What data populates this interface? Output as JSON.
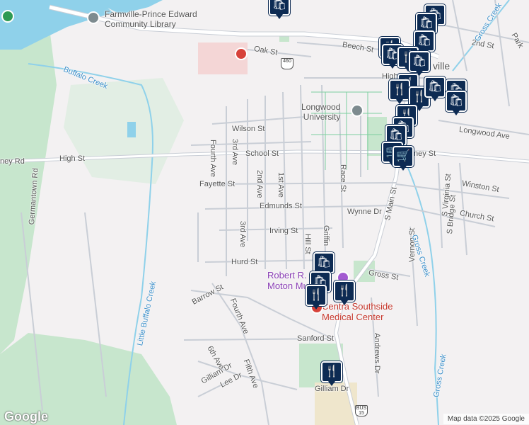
{
  "map": {
    "attribution": "Map data ©2025 Google",
    "logo": "Google",
    "colors": {
      "background": "#f3f1f2",
      "road": "#ffffff",
      "road_outline": "#c9ced6",
      "water": "#8fd1ea",
      "park": "#c7e6cd",
      "marker": "#0d2b53"
    }
  },
  "streets": {
    "high_st": "High St",
    "ney_rd": "ney Rd",
    "school_st": "School St",
    "wilson_st": "Wilson St",
    "fayette_st": "Fayette St",
    "edmunds_st": "Edmunds St",
    "irving_st": "Irving St",
    "hurd_st": "Hurd St",
    "barrow_st": "Barrow St",
    "sanford_st": "Sanford St",
    "gilliam_dr": "Gilliam Dr",
    "gilliam_dr_2": "Gilliam Dr",
    "lee_dr": "Lee Dr",
    "fifth_ave": "Fifth Ave",
    "sixth_ave": "6th Ave",
    "fourth_ave": "Fourth Ave",
    "fourth_ave_2": "Fourth Ave",
    "third_ave": "3rd Ave",
    "third_ave_2": "3rd Ave",
    "second_ave": "2nd Ave",
    "first_ave": "1st Ave",
    "hill_st": "Hill St",
    "griffin": "Griffin",
    "race_st": "Race St",
    "wynne_dr": "Wynne Dr",
    "s_main_st": "S Main St",
    "gross_st": "Gross St",
    "andrews_dr": "Andrews Dr",
    "vernon_st": "Vernon St",
    "s_virginia_st": "S Virginia St",
    "s_bridge_st": "S Bridge St",
    "church_st": "Church St",
    "winston_st": "Winston St",
    "longwood_ave": "Longwood Ave",
    "ney_st": "ney St",
    "oak_st": "Oak St",
    "beech_st": "Beech St",
    "high_fragment": "High",
    "second_st": "2nd St",
    "park_fragment": "Park",
    "germantown_rd": "Germantown Rd"
  },
  "water": {
    "buffalo_creek": "Buffalo Creek",
    "little_buffalo_creek": "Little Buffalo Creek",
    "gross_creek": "Gross Creek",
    "gross_creek_2": "Gross Creek",
    "gross_creek_3": "Gross Creek"
  },
  "places": {
    "library": "Farmville-Prince Edward\nCommunity Library",
    "university": "Longwood\nUniversity",
    "museum": "Robert R.\nMoton Mu",
    "medical": "Centra Southside\nMedical Center",
    "farmville_fragment": "ville"
  },
  "highway_shields": {
    "us460": "460",
    "bus15_top": "BUS",
    "bus15_num": "15"
  },
  "markers": [
    {
      "icon": "shopping-bag-icon",
      "glyph": "🛍"
    },
    {
      "icon": "restaurant-icon",
      "glyph": "🍴"
    },
    {
      "icon": "shopping-cart-icon",
      "glyph": "🛒"
    }
  ]
}
